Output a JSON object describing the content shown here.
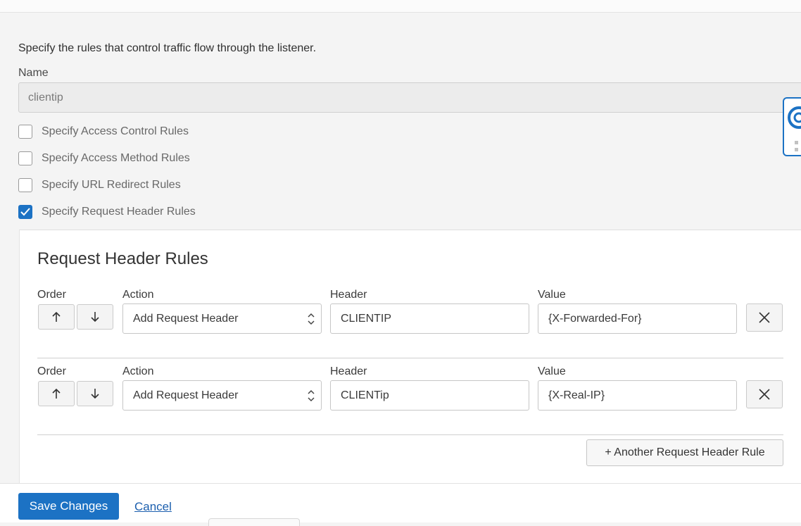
{
  "intro_text": "Specify the rules that control traffic flow through the listener.",
  "name_field": {
    "label": "Name",
    "value": "clientip"
  },
  "rule_types": [
    {
      "label": "Specify Access Control Rules",
      "checked": false
    },
    {
      "label": "Specify Access Method Rules",
      "checked": false
    },
    {
      "label": "Specify URL Redirect Rules",
      "checked": false
    },
    {
      "label": "Specify Request Header Rules",
      "checked": true
    }
  ],
  "request_header_rules": {
    "title": "Request Header Rules",
    "column_labels": {
      "order": "Order",
      "action": "Action",
      "header": "Header",
      "value": "Value"
    },
    "rules": [
      {
        "action": "Add Request Header",
        "header": "CLIENTIP",
        "value": "{X-Forwarded-For}"
      },
      {
        "action": "Add Request Header",
        "header": "CLIENTip",
        "value": "{X-Real-IP}"
      }
    ],
    "add_rule_label": "+ Another Request Header Rule"
  },
  "footer": {
    "save_label": "Save Changes",
    "cancel_label": "Cancel"
  },
  "colors": {
    "accent": "#1c72c4",
    "panel_bg": "#ffffff",
    "page_bg": "#f4f4f4"
  }
}
